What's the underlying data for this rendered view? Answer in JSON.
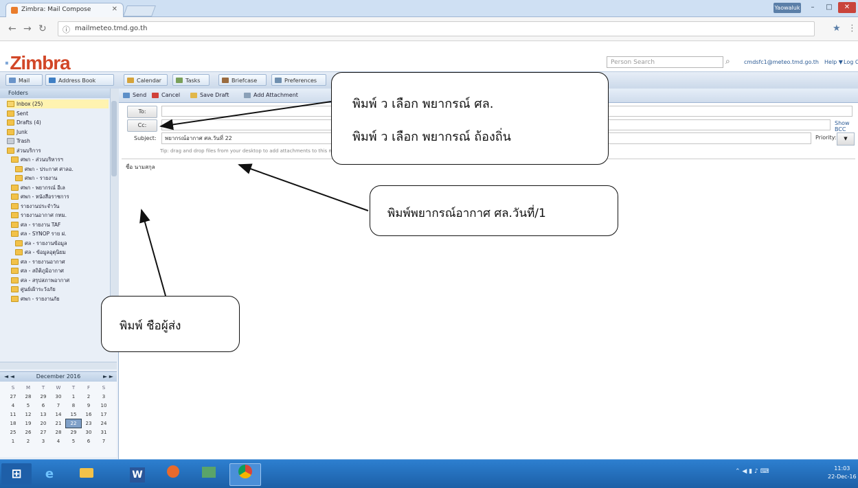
{
  "browser": {
    "tab_title": "Zimbra: Mail Compose",
    "url": "mailmeteo.tmd.go.th",
    "user_button": "Yaowaluk"
  },
  "zimbra": {
    "logo": "Zimbra",
    "search_placeholder": "Person Search",
    "user_email": "cmdsfc1@meteo.tmd.go.th",
    "help_label": "Help ▼",
    "logout_label": "Log Out"
  },
  "apptabs": [
    "Mail",
    "Address Book",
    "Calendar",
    "Tasks",
    "Briefcase",
    "Preferences"
  ],
  "sidebar": {
    "header": "Folders",
    "folders": [
      {
        "name": "Inbox (25)",
        "selected": true
      },
      {
        "name": "Sent"
      },
      {
        "name": "Drafts (4)"
      },
      {
        "name": "Junk"
      },
      {
        "name": "Trash"
      },
      {
        "name": "ส่วนบริการ"
      },
      {
        "name": "ศพก - ส่วนบริหารฯ"
      },
      {
        "name": "ศพก - ประกาศ ศาลอ."
      },
      {
        "name": "ศพก - รายงาน"
      },
      {
        "name": "ศพก - พยากรณ์ อีเล"
      },
      {
        "name": "ศพก - หนังสือราชการ"
      },
      {
        "name": "รายงานประจำวัน"
      },
      {
        "name": "รายงานอากาศ กทม."
      },
      {
        "name": "ศล - รายงาน TAF"
      },
      {
        "name": "ศล - SYNOP ราย ฝ."
      },
      {
        "name": "ศล - รายงานข้อมูล"
      },
      {
        "name": "ศล - ข้อมูลอุตุนิยม"
      },
      {
        "name": "ศล - รายงานอากาศ"
      },
      {
        "name": "ศล - สถิติภูมิอากาศ"
      },
      {
        "name": "ศล - สรุปสภาพอากาศ"
      },
      {
        "name": "ศูนย์เฝ้าระวังภัย"
      },
      {
        "name": "ศพก - รายงานภัย"
      }
    ]
  },
  "calendar": {
    "month_label": "December 2016",
    "nav_prev": "◄ ◄",
    "nav_next": "► ►",
    "dow": [
      "S",
      "M",
      "T",
      "W",
      "T",
      "F",
      "S"
    ],
    "days": [
      "27",
      "28",
      "29",
      "30",
      "1",
      "2",
      "3",
      "4",
      "5",
      "6",
      "7",
      "8",
      "9",
      "10",
      "11",
      "12",
      "13",
      "14",
      "15",
      "16",
      "17",
      "18",
      "19",
      "20",
      "21",
      "22",
      "23",
      "24",
      "25",
      "26",
      "27",
      "28",
      "29",
      "30",
      "31",
      "1",
      "2",
      "3",
      "4",
      "5",
      "6",
      "7"
    ],
    "today": "22"
  },
  "compose": {
    "toolbar": [
      "Send",
      "Cancel",
      "Save Draft",
      "Add Attachment"
    ],
    "to_label": "To:",
    "cc_label": "Cc:",
    "subject_label": "Subject:",
    "subject_value": "พยากรณ์อากาศ ศล.วันที่ 22",
    "show_bcc": "Show BCC",
    "priority_label": "Priority:",
    "priority_value": "",
    "attach_hint": "Tip: drag and drop files from your desktop to add attachments to this message.",
    "body_text": "ชื่อ นามสกุล"
  },
  "callouts": {
    "top_line1": "พิมพ์  ว  เลือก พยากรณ์ ศล.",
    "top_line2": "พิมพ์  ว  เลือก พยากรณ์  ถ้องถิ่น",
    "subject": "พิมพ์พยากรณ์อากาศ ศล.วันที่/1",
    "body": "พิมพ์ ชือผู้ส่ง"
  },
  "taskbar": {
    "icons": [
      "windows-start",
      "internet-explorer",
      "file-explorer",
      "word",
      "paint",
      "photos",
      "chrome"
    ],
    "clock_time": "11:03",
    "clock_date": "22-Dec-16"
  },
  "colors": {
    "zimbra_red": "#d24728",
    "accent_blue": "#2b5a94",
    "taskbar_blue": "#1c5fa6"
  }
}
